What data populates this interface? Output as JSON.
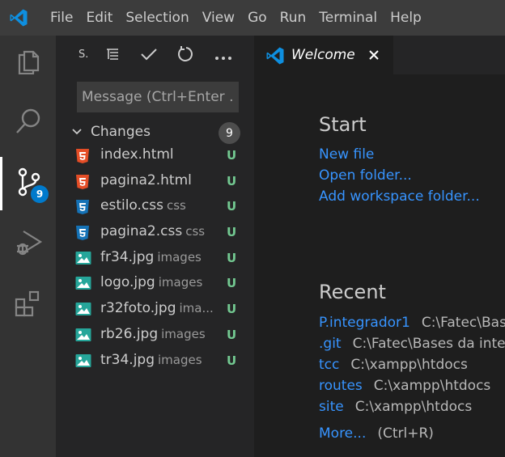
{
  "menu": [
    "File",
    "Edit",
    "Selection",
    "View",
    "Go",
    "Run",
    "Terminal",
    "Help"
  ],
  "activity": {
    "scm_badge": "9",
    "icons": [
      "files-icon",
      "search-icon",
      "source-control-icon",
      "run-debug-icon",
      "extensions-icon"
    ]
  },
  "sidebar": {
    "title": "S.",
    "message_placeholder": "Message (Ctrl+Enter ...",
    "changes_label": "Changes",
    "changes_count": "9",
    "files": [
      {
        "name": "index.html",
        "dir": "",
        "status": "U",
        "type": "html"
      },
      {
        "name": "pagina2.html",
        "dir": "",
        "status": "U",
        "type": "html"
      },
      {
        "name": "estilo.css",
        "dir": "css",
        "status": "U",
        "type": "css"
      },
      {
        "name": "pagina2.css",
        "dir": "css",
        "status": "U",
        "type": "css"
      },
      {
        "name": "fr34.jpg",
        "dir": "images",
        "status": "U",
        "type": "image"
      },
      {
        "name": "logo.jpg",
        "dir": "images",
        "status": "U",
        "type": "image"
      },
      {
        "name": "r32foto.jpg",
        "dir": "ima...",
        "status": "U",
        "type": "image"
      },
      {
        "name": "rb26.jpg",
        "dir": "images",
        "status": "U",
        "type": "image"
      },
      {
        "name": "tr34.jpg",
        "dir": "images",
        "status": "U",
        "type": "image"
      }
    ]
  },
  "editor": {
    "tab_label": "Welcome",
    "start_title": "Start",
    "start_links": [
      "New file",
      "Open folder...",
      "Add workspace folder..."
    ],
    "recent_title": "Recent",
    "recent": [
      {
        "name": "P.integrador1",
        "path": "C:\\Fatec\\Bas"
      },
      {
        "name": ".git",
        "path": "C:\\Fatec\\Bases da inter"
      },
      {
        "name": "tcc",
        "path": "C:\\xampp\\htdocs"
      },
      {
        "name": "routes",
        "path": "C:\\xampp\\htdocs"
      },
      {
        "name": "site",
        "path": "C:\\xampp\\htdocs"
      }
    ],
    "more_label": "More...",
    "more_shortcut": "(Ctrl+R)"
  },
  "colors": {
    "accent": "#007acc",
    "link": "#3794ff",
    "untracked": "#73c991",
    "html_icon": "#e44d26",
    "css_icon": "#1572b6",
    "image_icon": "#26a69a"
  }
}
